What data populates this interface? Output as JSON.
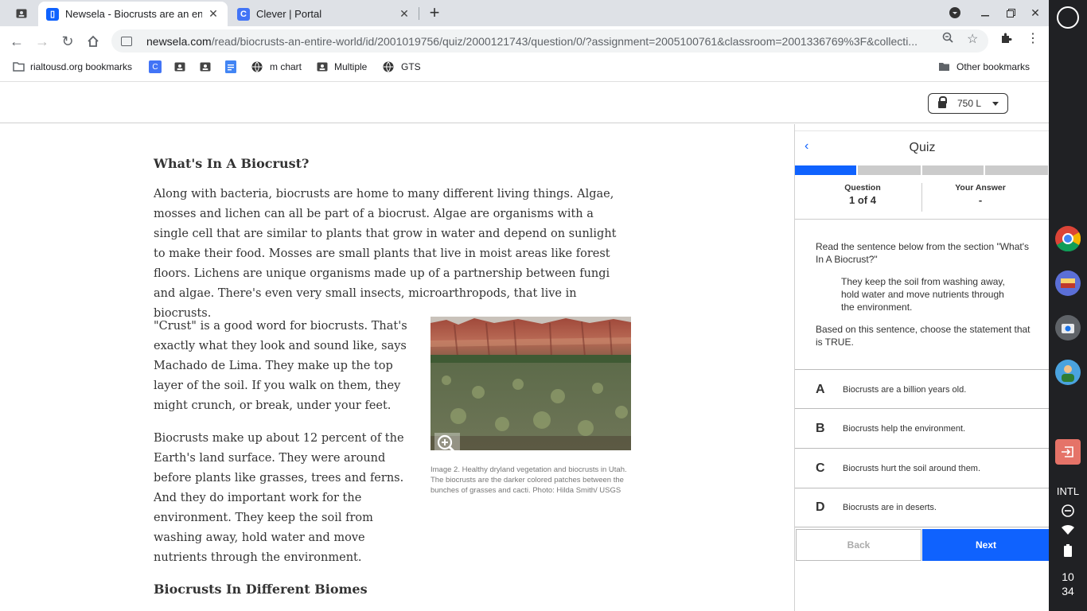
{
  "browser": {
    "tabs": [
      {
        "title": "Newsela - Biocrusts are an entire",
        "active": true
      },
      {
        "title": "Clever | Portal",
        "active": false
      }
    ],
    "new_tab": "+",
    "url_host": "newsela.com",
    "url_path": "/read/biocrusts-an-entire-world/id/2001019756/quiz/2000121743/question/0/?assignment=2005100761&classroom=2001336769%3F&collecti...",
    "bookmarks": [
      {
        "label": "rialtousd.org bookmarks",
        "icon": "folder-icon"
      },
      {
        "label": "",
        "icon": "clever-icon"
      },
      {
        "label": "",
        "icon": "contact-icon"
      },
      {
        "label": "",
        "icon": "contact-icon"
      },
      {
        "label": "",
        "icon": "doc-icon"
      },
      {
        "label": "m chart",
        "icon": "globe-icon"
      },
      {
        "label": "Multiple",
        "icon": "contact-icon"
      },
      {
        "label": "GTS",
        "icon": "globe-icon"
      }
    ],
    "other_bookmarks": "Other bookmarks"
  },
  "header": {
    "lexile": "750 L"
  },
  "article": {
    "heading1": "What's In A Biocrust?",
    "p1": "Along with bacteria, biocrusts are home to many different living things. Algae, mosses and lichen can all be part of a biocrust. Algae are organisms with a single cell that are similar to plants that grow in water and depend on sunlight to make their food. Mosses are small plants that live in moist areas like forest floors. Lichens are unique organisms made up of a partnership between fungi and algae. There's even very small insects, microarthropods, that live in biocrusts.",
    "p2": "\"Crust\" is a good word for biocrusts. That's exactly what they look and sound like, says Machado de Lima. They make up the top layer of the soil. If you walk on them, they might crunch, or break, under your feet.",
    "p3": "Biocrusts make up about 12 percent of the Earth's land surface. They were around before plants like grasses, trees and ferns. And they do important work for the environment. They keep the soil from washing away, hold water and move nutrients through the environment.",
    "caption": "Image 2. Healthy dryland vegetation and biocrusts in Utah. The biocrusts are the darker colored patches between the bunches of grasses and cacti. Photo: Hilda Smith/ USGS",
    "heading2": "Biocrusts In Different Biomes"
  },
  "quiz": {
    "title": "Quiz",
    "progress": {
      "answered": 0,
      "total": 4,
      "current": 1
    },
    "question_label": "Question",
    "question_value": "1 of 4",
    "answer_label": "Your Answer",
    "answer_value": "-",
    "prompt": "Read the sentence below from the section \"What's In A Biocrust?\"",
    "quote": "They keep the soil from washing away, hold water and move nutrients through the environment.",
    "instruction": "Based on this sentence, choose the statement that is TRUE.",
    "choices": [
      {
        "letter": "A",
        "text": "Biocrusts are a billion years old."
      },
      {
        "letter": "B",
        "text": "Biocrusts help the environment."
      },
      {
        "letter": "C",
        "text": "Biocrusts hurt the soil around them."
      },
      {
        "letter": "D",
        "text": "Biocrusts are in deserts."
      }
    ],
    "back_label": "Back",
    "next_label": "Next"
  },
  "shelf": {
    "ime": "INTL",
    "hour": "10",
    "minute": "34"
  },
  "colors": {
    "accent": "#0f62fe",
    "tabstrip": "#dee1e6",
    "shelf": "#202124"
  }
}
